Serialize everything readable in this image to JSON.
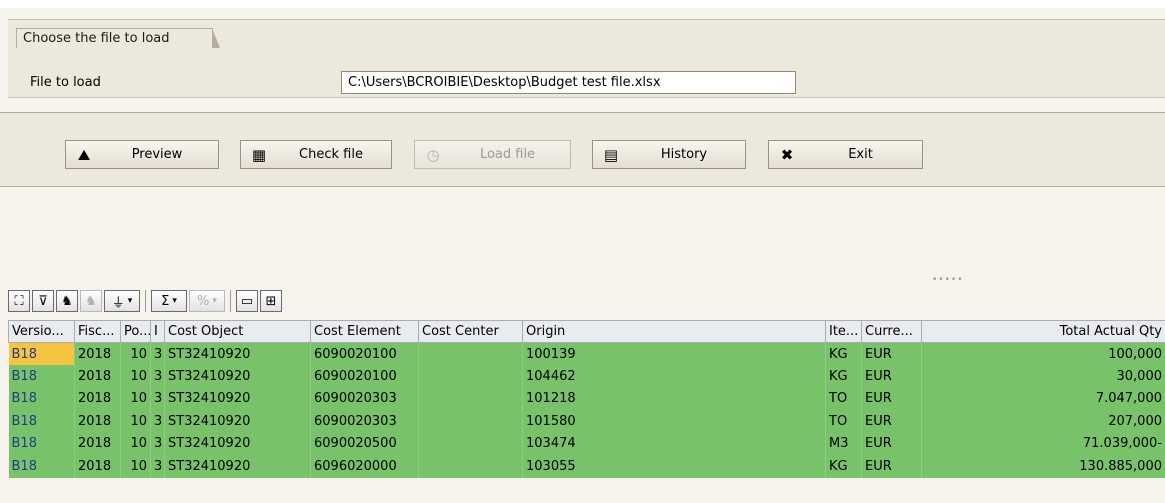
{
  "file_group": {
    "title": "Choose the file to load",
    "label": "File to load",
    "value": "C:\\Users\\BCROIBIE\\Desktop\\Budget test file.xlsx"
  },
  "buttons": [
    {
      "label": "Preview",
      "icon": "preview-icon",
      "glyph": "⛰"
    },
    {
      "label": "Check file",
      "icon": "check-file-icon",
      "glyph": "▦"
    },
    {
      "label": "Load file",
      "icon": "load-file-icon",
      "glyph": "◷",
      "disabled": true
    },
    {
      "label": "History",
      "icon": "history-icon",
      "glyph": "▤"
    },
    {
      "label": "Exit",
      "icon": "exit-icon",
      "glyph": "✖"
    }
  ],
  "toolbar": [
    {
      "icon": "details-icon",
      "glyph": "⛶"
    },
    {
      "icon": "sort-icon",
      "glyph": "⊽"
    },
    {
      "icon": "find-icon",
      "glyph": "♞"
    },
    {
      "icon": "find-next-icon",
      "glyph": "♞",
      "disabled": true
    },
    {
      "icon": "filter-icon",
      "glyph": "⏚"
    },
    {
      "icon": "sum-icon",
      "glyph": "Σ"
    },
    {
      "icon": "subtotal-icon",
      "glyph": "%",
      "disabled": true
    },
    {
      "icon": "print-icon",
      "glyph": "▭"
    },
    {
      "icon": "layout-icon",
      "glyph": "⊞"
    }
  ],
  "table": {
    "headers": [
      "Versio...",
      "Fisc...",
      "Po...",
      "I",
      "Cost Object",
      "Cost Element",
      "Cost Center",
      "Origin",
      "Ite...",
      "Curre...",
      "Total Actual Qty"
    ],
    "rows": [
      [
        "B18",
        "2018",
        "10",
        "3",
        "ST32410920",
        "6090020100",
        "",
        "100139",
        "KG",
        "EUR",
        "100,000"
      ],
      [
        "B18",
        "2018",
        "10",
        "3",
        "ST32410920",
        "6090020100",
        "",
        "104462",
        "KG",
        "EUR",
        "30,000"
      ],
      [
        "B18",
        "2018",
        "10",
        "3",
        "ST32410920",
        "6090020303",
        "",
        "101218",
        "TO",
        "EUR",
        "7.047,000"
      ],
      [
        "B18",
        "2018",
        "10",
        "3",
        "ST32410920",
        "6090020303",
        "",
        "101580",
        "TO",
        "EUR",
        "207,000"
      ],
      [
        "B18",
        "2018",
        "10",
        "3",
        "ST32410920",
        "6090020500",
        "",
        "103474",
        "M3",
        "EUR",
        "71.039,000-"
      ],
      [
        "B18",
        "2018",
        "10",
        "3",
        "ST32410920",
        "6096020000",
        "",
        "103055",
        "KG",
        "EUR",
        "130.885,000"
      ]
    ]
  },
  "colors": {
    "row_bg": "#78c36a",
    "cursor_cell": "#f5c542",
    "header_bg": "#e8ebf0",
    "group_bg": "#ece8db"
  }
}
